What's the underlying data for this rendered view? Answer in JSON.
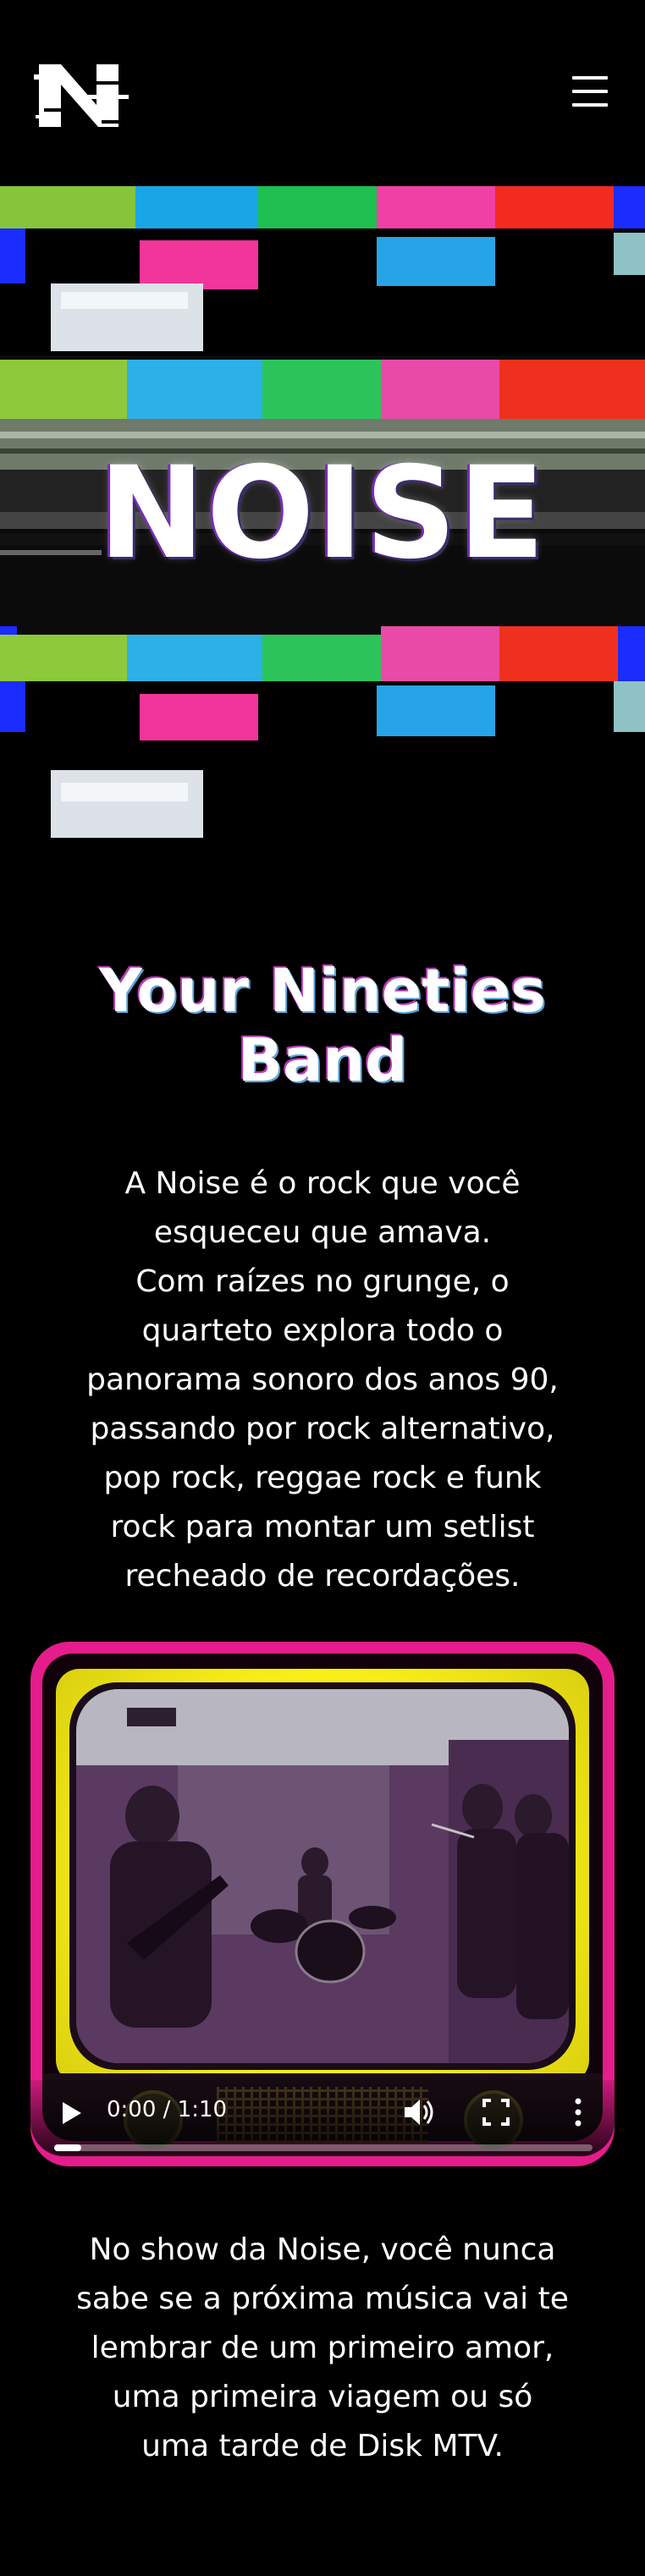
{
  "header": {
    "logo_icon": "noise-n-glitch-logo",
    "menu_icon": "hamburger-menu-icon"
  },
  "hero": {
    "title": "NOISE"
  },
  "intro": {
    "title": "Your Nineties Band",
    "text": "A Noise é o rock que você esqueceu que amava.\nCom raízes no grunge, o quarteto explora todo o panorama sonoro dos anos 90, passando por rock alternativo, pop rock, reggae rock e funk rock para montar um setlist recheado de recordações."
  },
  "video": {
    "time": "0:00 / 1:10",
    "progress": 0.05,
    "play_icon": "play-icon",
    "volume_icon": "volume-icon",
    "fullscreen_icon": "fullscreen-icon",
    "more_icon": "more-vertical-icon",
    "colors": {
      "tv_frame": "#e51c8b",
      "tv_body": "#f8ee18"
    }
  },
  "closing": {
    "text": "No show da Noise, você nunca sabe se a próxima música vai te lembrar de um primeiro amor, uma primeira viagem ou só uma tarde de Disk MTV."
  }
}
